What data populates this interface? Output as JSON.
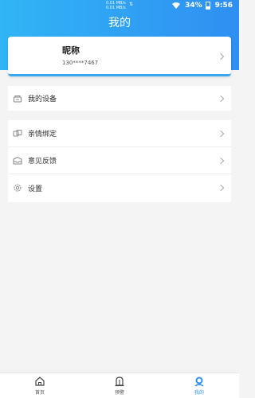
{
  "status_bar": {
    "net_speed_up": "0.01 MB/s",
    "net_speed_down": "0.01 MB/s",
    "battery": "34%",
    "time": "9:56"
  },
  "header": {
    "title": "我的"
  },
  "profile": {
    "nickname": "昵称",
    "phone": "130****7467"
  },
  "menu": {
    "group1": [
      {
        "label": "我的设备",
        "icon": "device-icon"
      }
    ],
    "group2": [
      {
        "label": "亲情绑定",
        "icon": "family-bind-icon"
      },
      {
        "label": "意见反馈",
        "icon": "feedback-icon"
      },
      {
        "label": "设置",
        "icon": "settings-icon"
      }
    ]
  },
  "tabbar": {
    "tabs": [
      {
        "label": "首页",
        "icon": "home-icon"
      },
      {
        "label": "预警",
        "icon": "alert-bell-icon"
      },
      {
        "label": "我的",
        "icon": "profile-icon",
        "active": true
      }
    ]
  },
  "colors": {
    "accent": "#2f8ff2",
    "header_start": "#31b5f5"
  }
}
